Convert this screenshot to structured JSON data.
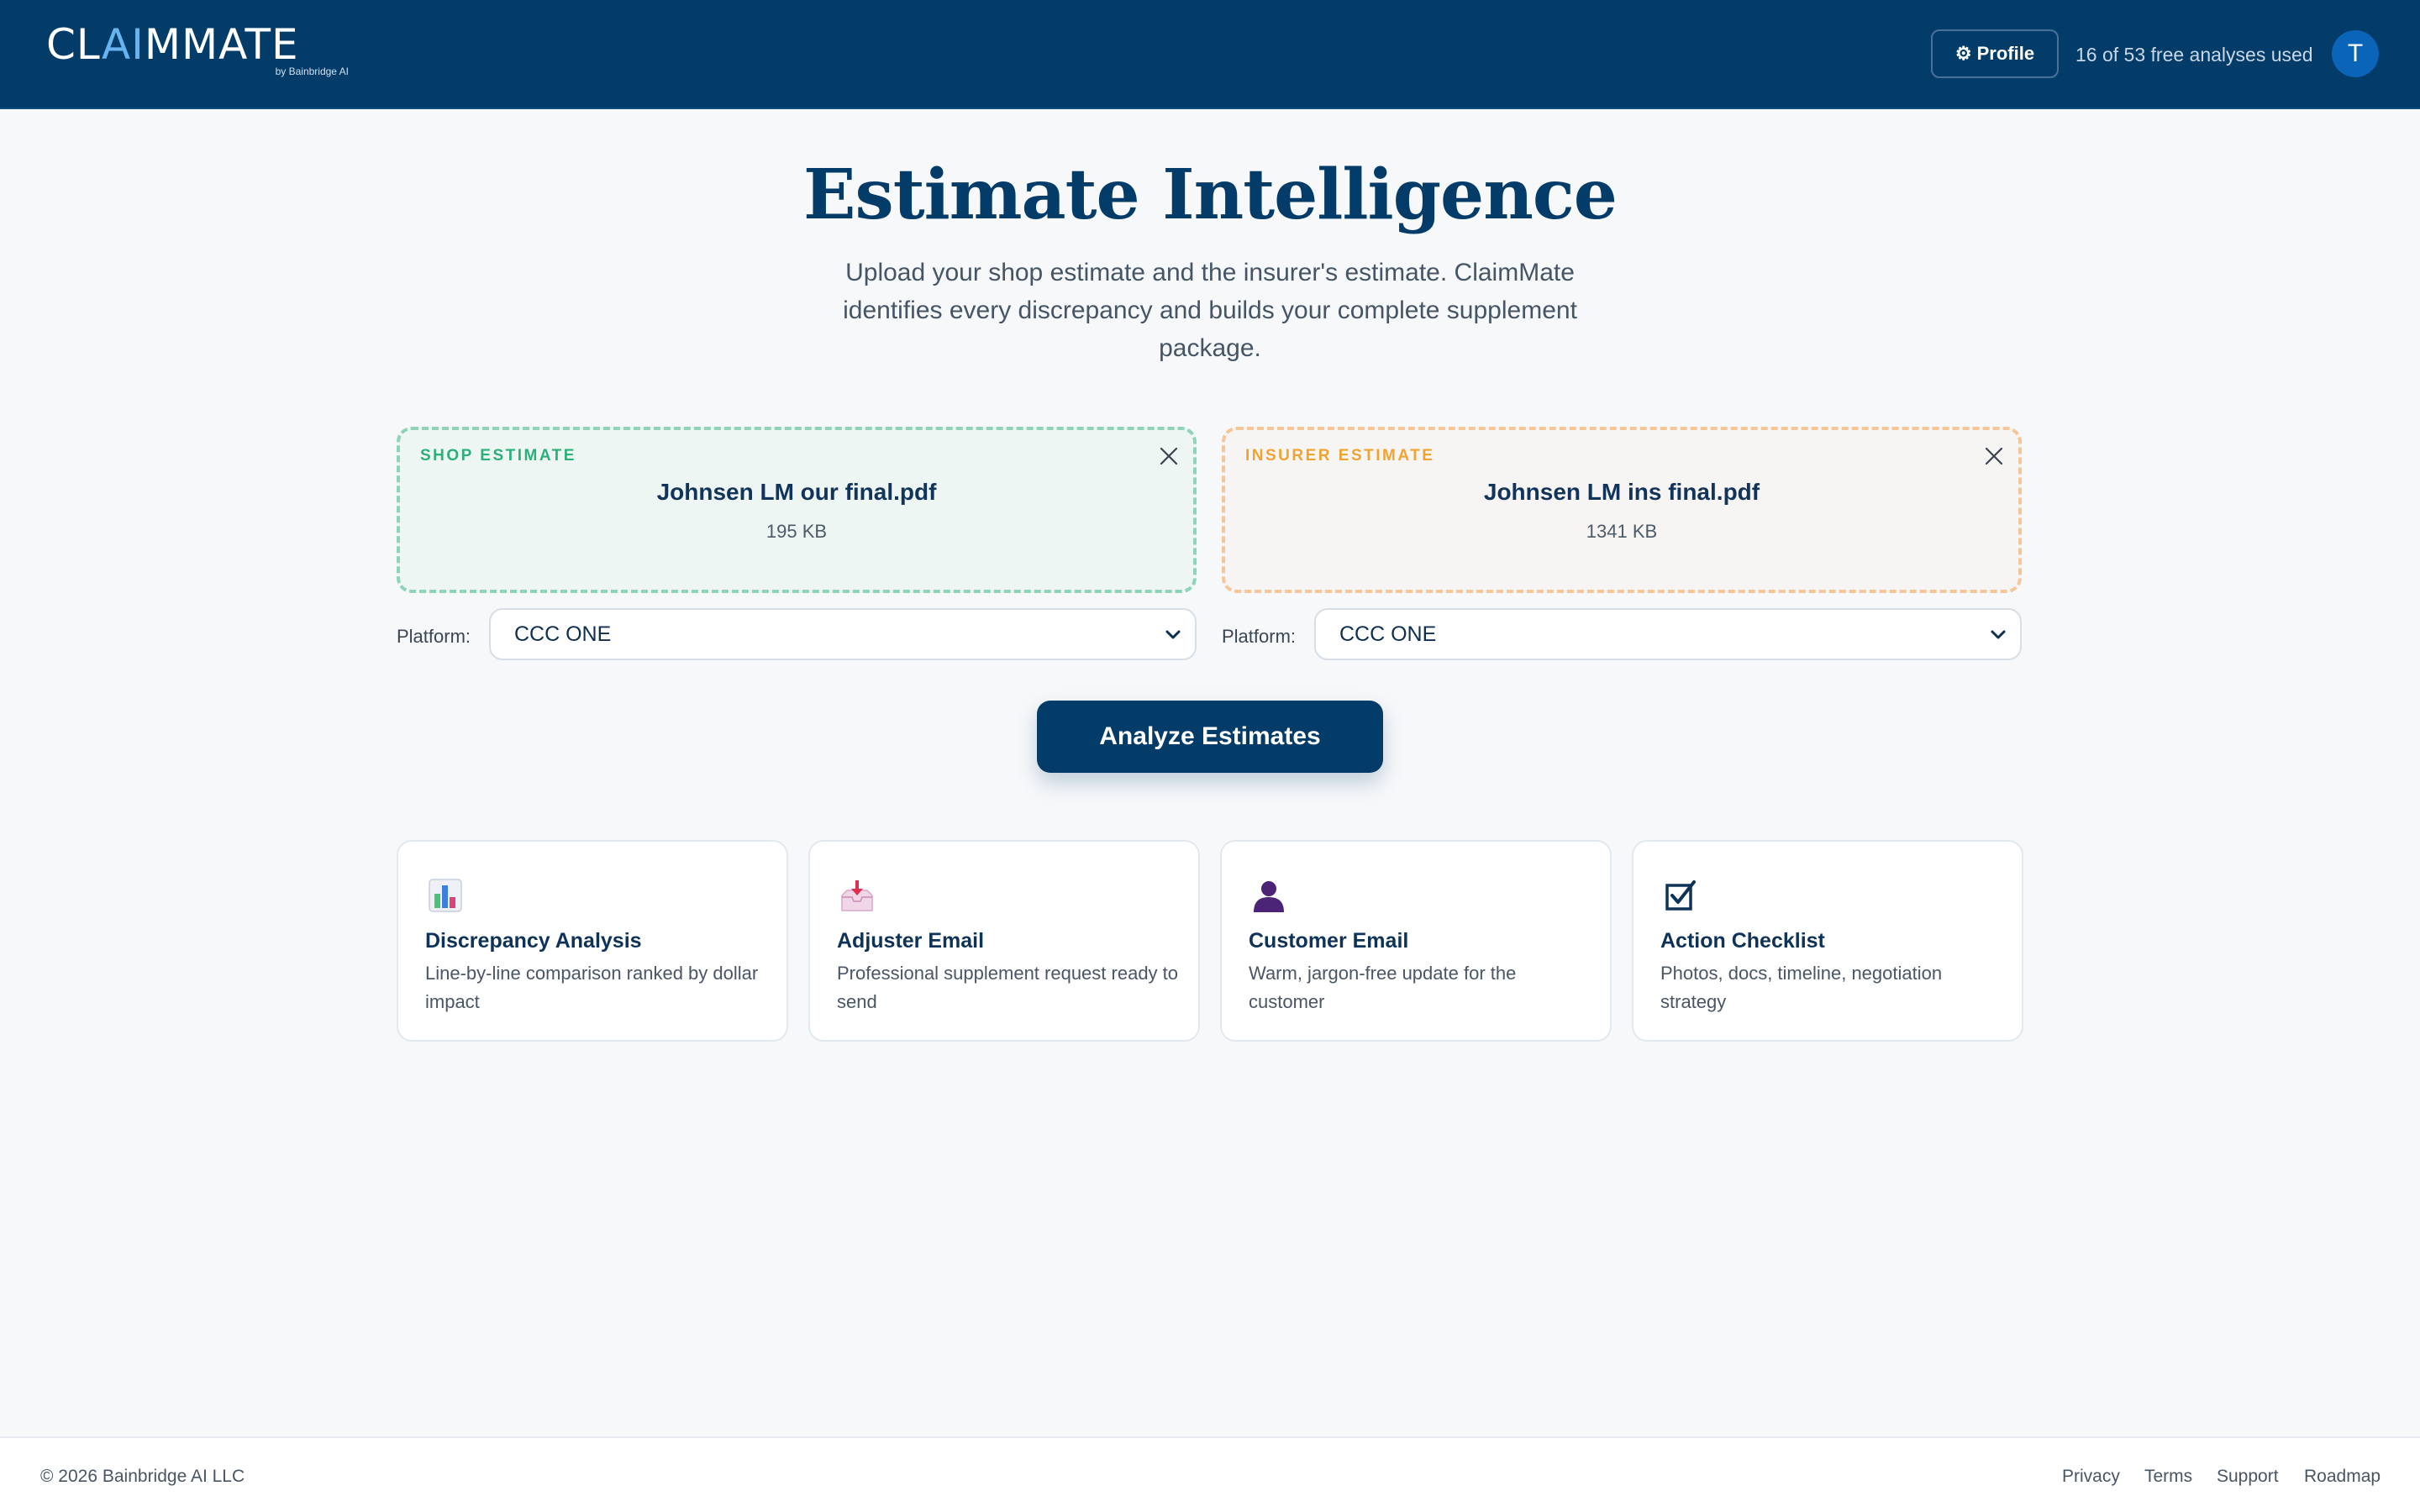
{
  "header": {
    "logo_text_pre": "CL",
    "logo_text_ai": "AI",
    "logo_text_post": "MMATE",
    "logo_sub": "by Bainbridge AI",
    "profile_label": "Profile",
    "profile_icon": "⚙",
    "usage_text": "16 of 53 free analyses used",
    "avatar_initial": "T"
  },
  "hero": {
    "title": "Estimate Intelligence",
    "subtitle": "Upload your shop estimate and the insurer's estimate. ClaimMate identifies every discrepancy and builds your complete supplement package."
  },
  "uploads": {
    "shop": {
      "label": "SHOP ESTIMATE",
      "file_name": "Johnsen LM our final.pdf",
      "file_size": "195 KB",
      "platform_label": "Platform:",
      "platform_value": "CCC ONE"
    },
    "insurer": {
      "label": "INSURER ESTIMATE",
      "file_name": "Johnsen LM ins final.pdf",
      "file_size": "1341 KB",
      "platform_label": "Platform:",
      "platform_value": "CCC ONE"
    }
  },
  "analyze_label": "Analyze Estimates",
  "features": [
    {
      "icon": "bar-chart-icon",
      "title": "Discrepancy Analysis",
      "desc": "Line-by-line comparison ranked by dollar impact"
    },
    {
      "icon": "inbox-tray-icon",
      "title": "Adjuster Email",
      "desc": "Professional supplement request ready to send"
    },
    {
      "icon": "person-icon",
      "title": "Customer Email",
      "desc": "Warm, jargon-free update for the customer"
    },
    {
      "icon": "checkbox-icon",
      "title": "Action Checklist",
      "desc": "Photos, docs, timeline, negotiation strategy"
    }
  ],
  "footer": {
    "copyright": "© 2026 Bainbridge AI LLC",
    "links": [
      "Privacy",
      "Terms",
      "Support",
      "Roadmap"
    ]
  },
  "colors": {
    "primary": "#043c69",
    "shop_accent": "#2bb07a",
    "insurer_accent": "#f0a330",
    "page_bg": "#f6f8fa"
  }
}
